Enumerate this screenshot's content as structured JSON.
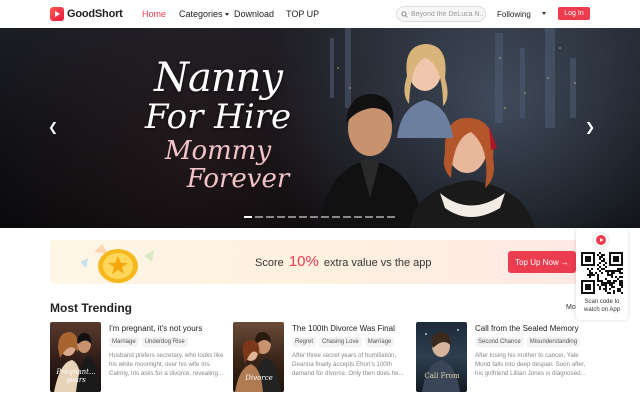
{
  "brand": {
    "name": "GoodShort",
    "accent": "#ec3c4f"
  },
  "nav": {
    "home": "Home",
    "categories": "Categories",
    "download": "Download",
    "topup": "TOP UP"
  },
  "search": {
    "placeholder": "Beyond the DeLuca N..."
  },
  "header": {
    "following": "Following",
    "login": "Log In"
  },
  "banner": {
    "title_line1": "Nanny",
    "title_line2": "For Hire",
    "title_line3": "Mommy",
    "title_line4": "Forever",
    "slide_count": 14,
    "active_slide": 0
  },
  "promo": {
    "text_before": "Score",
    "percent": "10%",
    "text_after": "extra value vs the app",
    "button": "Top Up Now →"
  },
  "qr": {
    "caption_line1": "Scan code to",
    "caption_line2": "watch on App"
  },
  "trending": {
    "title": "Most Trending",
    "more": "Mo",
    "items": [
      {
        "title": "I'm pregnant, it's not yours",
        "tags": [
          "Marriage",
          "Underdog Rise"
        ],
        "desc": "Husband prefers secretary, who looks like his white moonlight, over his wife Iris. Calmly, Iris asks for a divorce, revealing...",
        "cover_text": "Pregnant... yours"
      },
      {
        "title": "The 100th Divorce Was Final",
        "tags": [
          "Regret",
          "Chasing Love",
          "Marriage"
        ],
        "desc": "After three secret years of humiliation, Deanna finally accepts Ehon's 100th demand for divorce. Only then does he...",
        "cover_text": "Divorce"
      },
      {
        "title": "Call from the Sealed Memory",
        "tags": [
          "Second Chance",
          "Misunderstanding"
        ],
        "desc": "After losing his mother to cancer, Yale Mond falls into deep despair. Soon after, his girlfriend Lillian Jones is diagnosed...",
        "cover_text": "Call From"
      }
    ]
  }
}
